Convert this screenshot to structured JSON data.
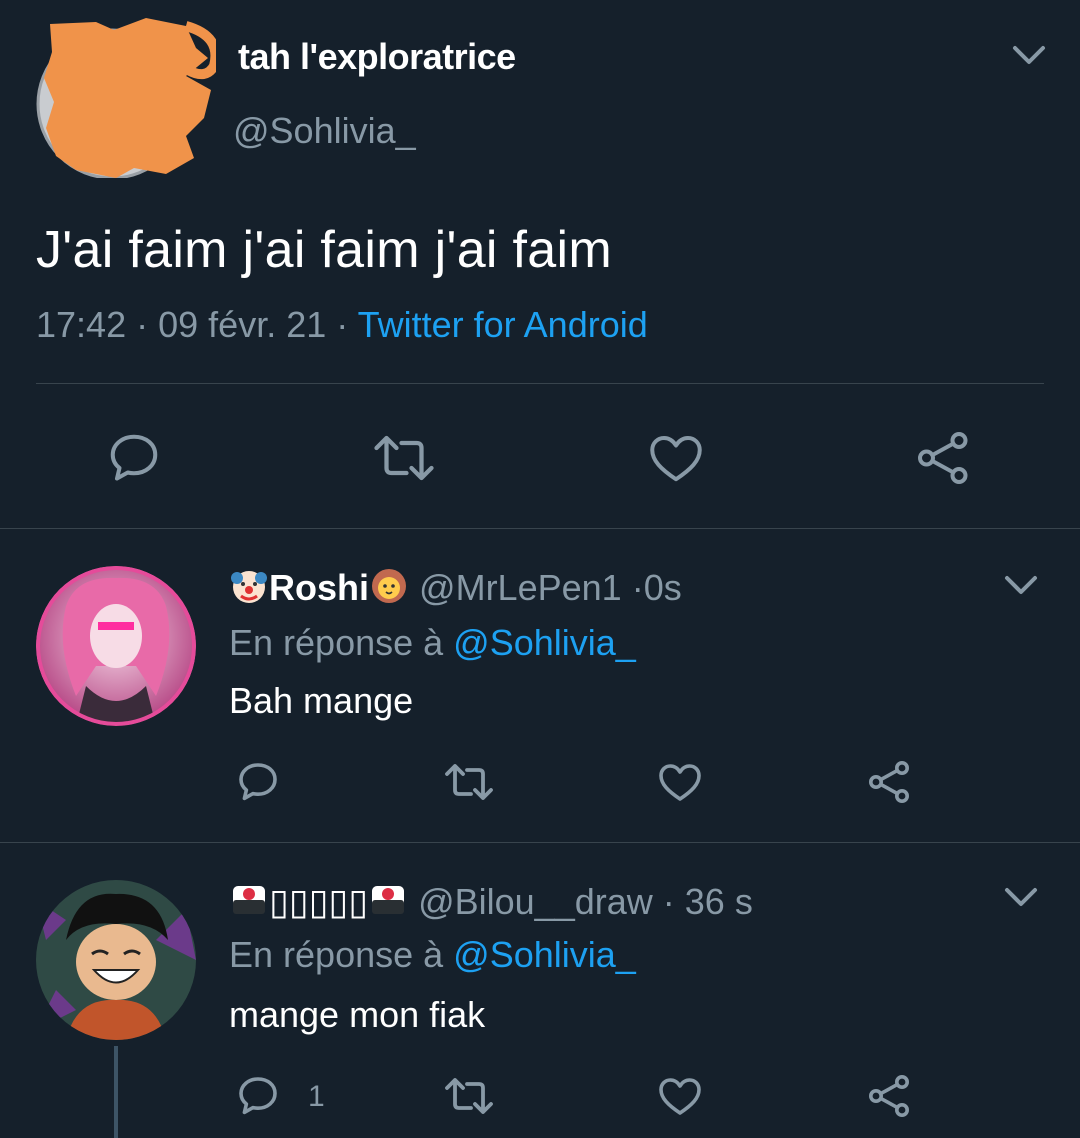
{
  "main_tweet": {
    "display_name": "tah l'exploratrice",
    "handle": "@Sohlivia_",
    "text": "J'ai faim j'ai faim j'ai faim",
    "time": "17:42",
    "date": "09 févr. 21",
    "separator": "·",
    "source": "Twitter for Android"
  },
  "replies": [
    {
      "name": "Roshi",
      "handle": "@MrLePen1",
      "time": "0s",
      "separator": "·",
      "reply_prefix": "En réponse à",
      "reply_to": "@Sohlivia_",
      "text": "Bah mange",
      "reply_count": ""
    },
    {
      "name": "▯▯▯▯▯",
      "handle": "@Bilou__draw",
      "time": "36 s",
      "separator": "·",
      "reply_prefix": "En réponse à",
      "reply_to": "@Sohlivia_",
      "text": "mange mon fiak",
      "reply_count": "1"
    }
  ],
  "icons": [
    "chevron-down-icon",
    "reply-icon",
    "retweet-icon",
    "like-icon",
    "share-icon",
    "clown-emoji",
    "lion-emoji",
    "sushi-emoji"
  ],
  "colors": {
    "background": "#15202b",
    "text": "#ffffff",
    "muted": "#8899a6",
    "link": "#1da1f2",
    "divider": "#38444d",
    "redaction": "#f0934a"
  }
}
